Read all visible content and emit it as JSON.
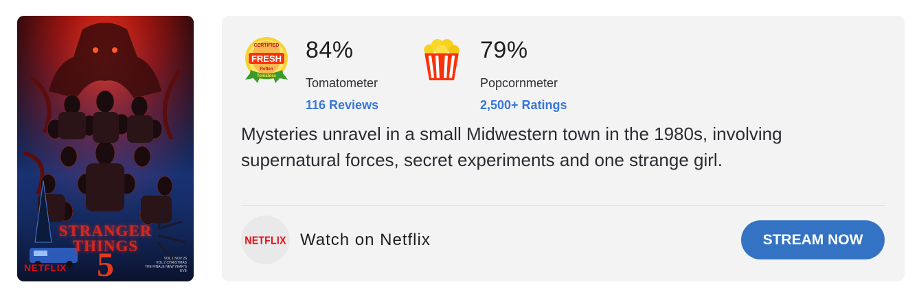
{
  "poster": {
    "title_line1": "STRANGER",
    "title_line2": "THINGS",
    "season_number": "5",
    "brand": "NETFLIX",
    "release_line1": "VOL 1 NOV 26",
    "release_line2": "VOL 2 CHRISTMAS",
    "release_line3": "THE FINALE NEW YEAR'S EVE"
  },
  "tomatometer": {
    "badge_top": "CERTIFIED",
    "badge_main": "FRESH",
    "badge_sub1": "Rotten",
    "badge_sub2": "Tomatoes",
    "percent": "84%",
    "label": "Tomatometer",
    "reviews_link": "116 Reviews"
  },
  "popcornmeter": {
    "percent": "79%",
    "label": "Popcornmeter",
    "ratings_link": "2,500+ Ratings"
  },
  "synopsis": "Mysteries unravel in a small Midwestern town in the 1980s, involving supernatural forces, secret experiments and one strange girl.",
  "provider": {
    "logo_text": "NETFLIX",
    "watch_label": "Watch on Netflix",
    "button_label": "STREAM NOW"
  },
  "colors": {
    "link": "#3976dc",
    "button": "#3473c4",
    "netflix_red": "#e50914",
    "card_bg": "#f3f3f3"
  },
  "icons": [
    "certified-fresh-icon",
    "popcorn-bucket-icon",
    "netflix-logo-icon"
  ]
}
